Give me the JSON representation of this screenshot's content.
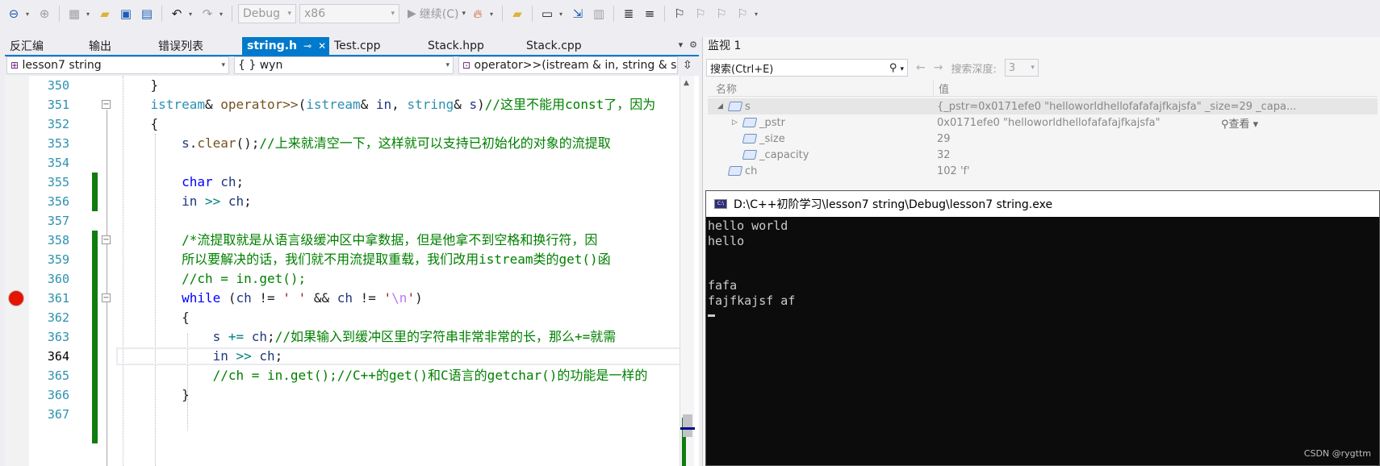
{
  "toolbar": {
    "config": "Debug",
    "platform": "x86",
    "continue_label": "继续(C)",
    "icons": [
      "back-icon",
      "forward-icon",
      "new-project-icon",
      "open-icon",
      "save-icon",
      "save-all-icon",
      "undo-icon",
      "redo-icon",
      "play-icon",
      "hot-reload-icon",
      "folder-browse-icon",
      "window-layout-icon",
      "step-icon",
      "bookmark-icon"
    ]
  },
  "doc_tabs": [
    {
      "label": "反汇编"
    },
    {
      "label": "输出"
    },
    {
      "label": "错误列表"
    },
    {
      "label": "string.h"
    },
    {
      "label": "Test.cpp"
    },
    {
      "label": "Stack.hpp"
    },
    {
      "label": "Stack.cpp"
    }
  ],
  "nav": {
    "project": "lesson7 string",
    "scope": "{ } wyn",
    "member": "operator>>(istream & in, string & s"
  },
  "code_lines": [
    {
      "num": "350",
      "text": "    }"
    },
    {
      "num": "351",
      "text": "    istream& operator>>(istream& in, string& s)//这里不能用const了，因为"
    },
    {
      "num": "352",
      "text": "    {"
    },
    {
      "num": "353",
      "text": "        s.clear();//上来就清空一下，这样就可以支持已初始化的对象的流提取"
    },
    {
      "num": "354",
      "text": ""
    },
    {
      "num": "355",
      "text": "        char ch;"
    },
    {
      "num": "356",
      "text": "        in >> ch;"
    },
    {
      "num": "357",
      "text": ""
    },
    {
      "num": "358",
      "text": "        /*流提取就是从语言级缓冲区中拿数据，但是他拿不到空格和换行符，因"
    },
    {
      "num": "359",
      "text": "        所以要解决的话，我们就不用流提取重载，我们改用istream类的get()函"
    },
    {
      "num": "360",
      "text": "        //ch = in.get();"
    },
    {
      "num": "361",
      "text": "        while (ch != ' ' && ch != '\\n')"
    },
    {
      "num": "362",
      "text": "        {"
    },
    {
      "num": "363",
      "text": "            s += ch;//如果输入到缓冲区里的字符串非常非常的长，那么+=就需"
    },
    {
      "num": "364",
      "text": "            in >> ch;"
    },
    {
      "num": "365",
      "text": "            //ch = in.get();//C++的get()和C语言的getchar()的功能是一样的"
    },
    {
      "num": "366",
      "text": "        }"
    },
    {
      "num": "367",
      "text": ""
    }
  ],
  "watch": {
    "title": "监视 1",
    "search_placeholder": "搜索(Ctrl+E)",
    "depth_label": "搜索深度:",
    "depth_value": "3",
    "col_name": "名称",
    "col_value": "值",
    "view_label": "查看",
    "rows": [
      {
        "name": "s",
        "value": "{_pstr=0x0171efe0 \"helloworldhellofafafajfkajsfa\" _size=29 _capa...",
        "indent": 0,
        "expander": "◢"
      },
      {
        "name": "_pstr",
        "value": "0x0171efe0 \"helloworldhellofafafajfkajsfa\"",
        "indent": 1,
        "expander": "▷"
      },
      {
        "name": "_size",
        "value": "29",
        "indent": 1,
        "expander": ""
      },
      {
        "name": "_capacity",
        "value": "32",
        "indent": 1,
        "expander": ""
      },
      {
        "name": "ch",
        "value": "102 'f'",
        "indent": 0,
        "expander": ""
      }
    ]
  },
  "console": {
    "title": "D:\\C++初阶学习\\lesson7 string\\Debug\\lesson7 string.exe",
    "output": "hello world\nhello\n\n\nfafa\nfajfkajsf af\n"
  },
  "watermark": "CSDN @rygttm"
}
